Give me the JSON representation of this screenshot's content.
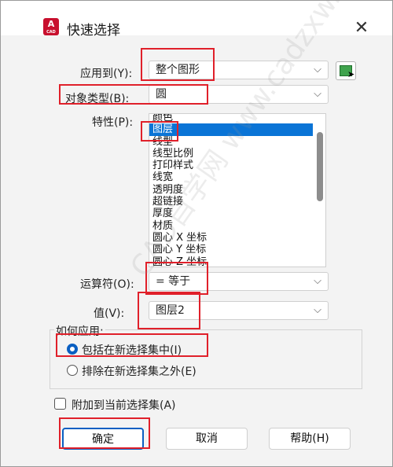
{
  "window": {
    "title": "快速选择",
    "app_icon": {
      "letter": "A",
      "sub": "CAD"
    },
    "close_glyph": "✕"
  },
  "form": {
    "apply_to": {
      "label": "应用到(Y):",
      "value": "整个图形"
    },
    "object_type": {
      "label": "对象类型(B):",
      "value": "圆"
    },
    "properties": {
      "label": "特性(P):",
      "items": [
        "颜色",
        "图层",
        "线型",
        "线型比例",
        "打印样式",
        "线宽",
        "透明度",
        "超链接",
        "厚度",
        "材质",
        "圆心 X 坐标",
        "圆心 Y 坐标",
        "圆心 Z 坐标"
      ],
      "selected_index": 1
    },
    "operator": {
      "label": "运算符(O):",
      "value": "= 等于"
    },
    "value": {
      "label": "值(V):",
      "value": "图层2"
    }
  },
  "how_to_apply": {
    "title": "如何应用:",
    "include": "包括在新选择集中(I)",
    "exclude": "排除在新选择集之外(E)",
    "selected": "include"
  },
  "append": {
    "label": "附加到当前选择集(A)",
    "checked": false
  },
  "buttons": {
    "ok": "确定",
    "cancel": "取消",
    "help": "帮助(H)"
  },
  "watermark": "CAD自学网 www.cadzxw.com",
  "colors": {
    "accent": "#0a74d6",
    "highlight": "#e0202a",
    "pick_icon": "#3fa34d"
  }
}
